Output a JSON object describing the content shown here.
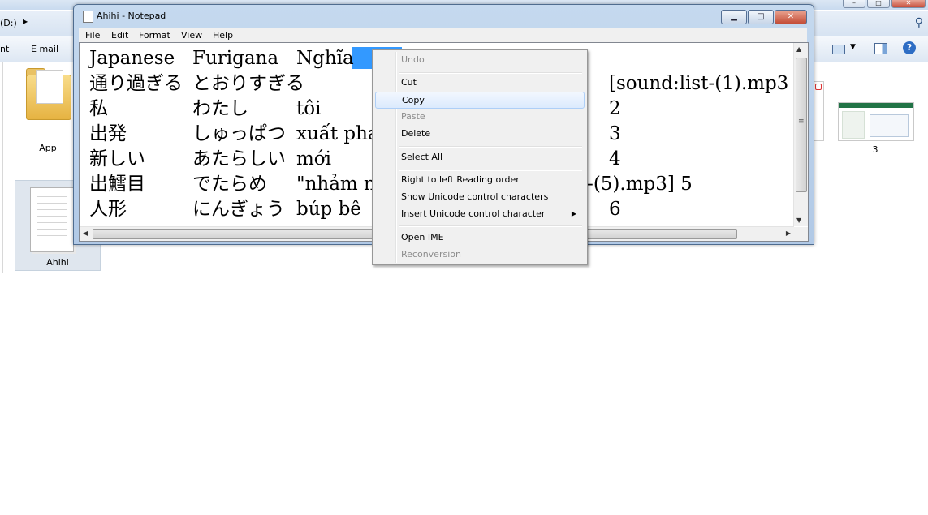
{
  "explorer": {
    "address_drive": "(D:)",
    "toolbar_left": "nt",
    "toolbar_email": "E mail",
    "files": [
      {
        "label": "App"
      },
      {
        "label": "Ahihi"
      },
      {
        "label": "3"
      }
    ]
  },
  "notepad": {
    "title": "Ahihi - Notepad",
    "menu": [
      "File",
      "Edit",
      "Format",
      "View",
      "Help"
    ],
    "rows": [
      [
        "Japanese",
        "Furigana",
        "Nghĩa",
        ""
      ],
      [
        "通り過ぎる",
        "とおりすぎる",
        "",
        "[sound:list-(1).mp3"
      ],
      [
        "私",
        "わたし",
        "tôi",
        "2"
      ],
      [
        "出発",
        "しゅっぱつ",
        "xuất phá",
        "3"
      ],
      [
        "新しい",
        "あたらしい",
        "mới",
        "4"
      ],
      [
        "出鱈目",
        "でたらめ",
        "\"nhảm n",
        "st-(5).mp3]    5"
      ],
      [
        "人形",
        "にんぎょう",
        "búp bê",
        "6"
      ]
    ]
  },
  "context_menu": {
    "items": [
      {
        "label": "Undo",
        "enabled": false
      },
      {
        "label": "Cut",
        "enabled": true
      },
      {
        "label": "Copy",
        "enabled": true,
        "highlighted": true
      },
      {
        "label": "Paste",
        "enabled": false
      },
      {
        "label": "Delete",
        "enabled": true
      },
      {
        "label": "Select All",
        "enabled": true
      },
      {
        "label": "Right to left Reading order",
        "enabled": true
      },
      {
        "label": "Show Unicode control characters",
        "enabled": true
      },
      {
        "label": "Insert Unicode control character",
        "enabled": true,
        "submenu": true
      },
      {
        "label": "Open IME",
        "enabled": true
      },
      {
        "label": "Reconversion",
        "enabled": false
      }
    ]
  },
  "colors": {
    "selection": "#3399ff",
    "menu_highlight": "#dbeafd"
  }
}
